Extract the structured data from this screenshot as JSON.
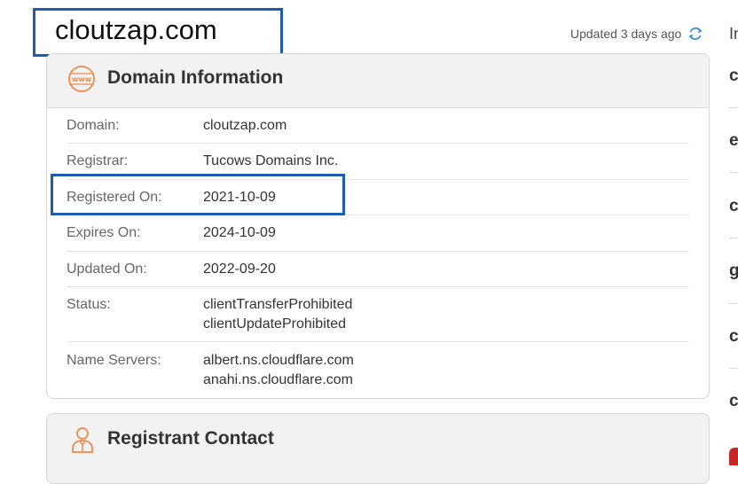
{
  "page": {
    "domain_title": "cloutzap.com",
    "updated_text": "Updated 3 days ago"
  },
  "domain_info": {
    "title": "Domain Information",
    "rows": [
      {
        "label": "Domain:",
        "value": "cloutzap.com"
      },
      {
        "label": "Registrar:",
        "value": "Tucows Domains Inc."
      },
      {
        "label": "Registered On:",
        "value": "2021-10-09"
      },
      {
        "label": "Expires On:",
        "value": "2024-10-09"
      },
      {
        "label": "Updated On:",
        "value": "2022-09-20"
      },
      {
        "label": "Status:",
        "values": [
          "clientTransferProhibited",
          "clientUpdateProhibited"
        ]
      },
      {
        "label": "Name Servers:",
        "values": [
          "albert.ns.cloudflare.com",
          "anahi.ns.cloudflare.com"
        ]
      }
    ]
  },
  "registrant": {
    "title": "Registrant Contact"
  },
  "right_column": {
    "heading": "In",
    "items": [
      "c",
      "e",
      "c",
      "g",
      "c",
      "c"
    ]
  },
  "colors": {
    "highlight_border": "#1f5ab3",
    "icon_orange": "#f08a4b",
    "refresh_blue": "#3b8fd9"
  }
}
